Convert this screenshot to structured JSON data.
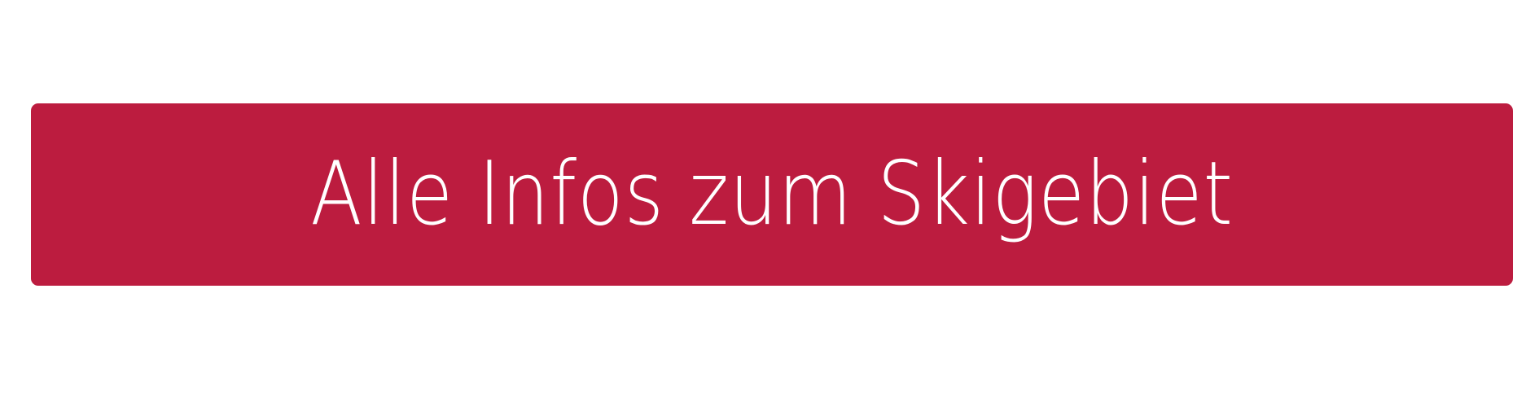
{
  "cta": {
    "label": "Alle Infos zum Skigebiet",
    "background_color": "#BC1C3F",
    "text_color": "#FFFFFF"
  }
}
